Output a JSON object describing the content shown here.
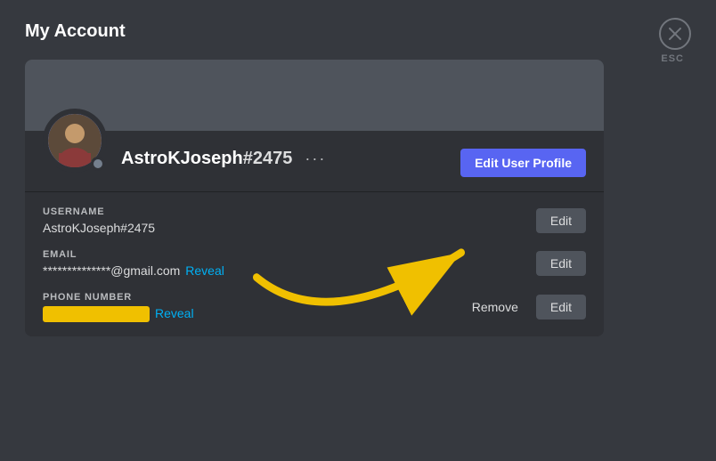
{
  "page": {
    "title": "My Account",
    "close_label": "ESC"
  },
  "profile": {
    "username": "AstroKJoseph",
    "discriminator": "#2475",
    "dots_label": "···",
    "edit_profile_button": "Edit User Profile",
    "status_indicator": "offline"
  },
  "fields": [
    {
      "label": "USERNAME",
      "value": "AstroKJoseph#2475",
      "edit_label": "Edit",
      "has_reveal": false,
      "has_remove": false
    },
    {
      "label": "EMAIL",
      "value": "**************@gmail.com",
      "reveal_label": "Reveal",
      "edit_label": "Edit",
      "has_reveal": true,
      "has_remove": false
    },
    {
      "label": "PHONE NUMBER",
      "value": "",
      "reveal_label": "Reveal",
      "edit_label": "Edit",
      "remove_label": "Remove",
      "has_reveal": true,
      "has_remove": true
    }
  ]
}
